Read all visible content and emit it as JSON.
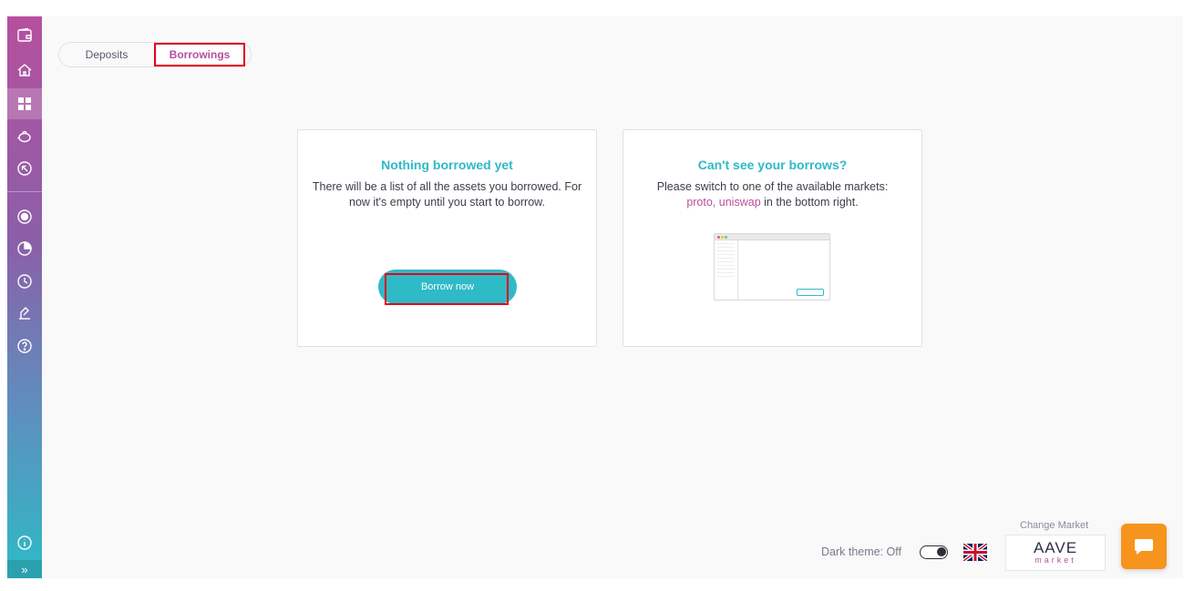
{
  "sidebar": {
    "items": [
      {
        "name": "wallet-icon"
      },
      {
        "name": "home-icon"
      },
      {
        "name": "dashboard-icon",
        "active": true
      },
      {
        "name": "deposit-icon"
      },
      {
        "name": "borrow-icon"
      },
      {
        "name": "reserve-overview-icon"
      },
      {
        "name": "markets-chart-icon"
      },
      {
        "name": "history-icon"
      },
      {
        "name": "governance-icon"
      },
      {
        "name": "help-icon"
      }
    ],
    "info_icon": "info-icon",
    "expand_label": "»"
  },
  "tabs": {
    "deposits": "Deposits",
    "borrowings": "Borrowings",
    "active": "borrowings"
  },
  "card_empty": {
    "title": "Nothing borrowed yet",
    "text": "There will be a list of all the assets you borrowed. For now it's empty until you start to borrow.",
    "button": "Borrow now"
  },
  "card_markets": {
    "title": "Can't see your borrows?",
    "text_before": "Please switch to one of the available markets:",
    "market_1": "proto",
    "separator": ",",
    "market_2": "uniswap",
    "text_after": "in the bottom right."
  },
  "footer": {
    "dark_theme_label": "Dark theme: Off",
    "dark_theme_on": false,
    "language_icon": "uk-flag-icon",
    "change_market_label": "Change Market",
    "market_logo_text": "AAVE",
    "market_logo_sub": "market",
    "chat_icon": "chat-icon"
  },
  "colors": {
    "brand_pink": "#b6509e",
    "brand_teal": "#2ebac6",
    "chat_orange": "#f7941d"
  }
}
